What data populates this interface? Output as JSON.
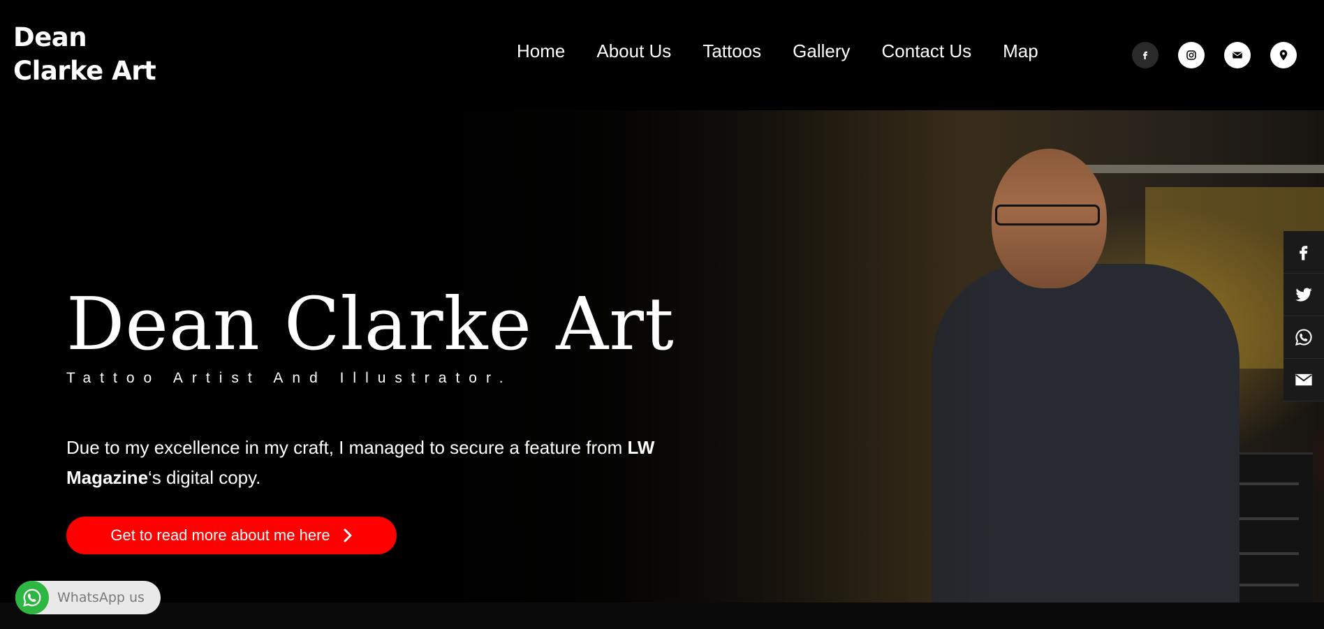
{
  "header": {
    "logo_line1": "Dean",
    "logo_line2": "Clarke Art",
    "nav": [
      {
        "label": "Home"
      },
      {
        "label": "About Us"
      },
      {
        "label": "Tattoos"
      },
      {
        "label": "Gallery"
      },
      {
        "label": "Contact Us"
      },
      {
        "label": "Map"
      }
    ],
    "social_icons": [
      "facebook-icon",
      "instagram-icon",
      "envelope-icon",
      "map-pin-icon"
    ]
  },
  "hero": {
    "title": "Dean Clarke Art",
    "subtitle": "Tattoo Artist And Illustrator.",
    "text_part1": "Due to my excellence in my craft, I managed to secure a feature from ",
    "text_bold": "LW Magazine",
    "text_part2": "‘s digital copy.",
    "cta_label": "Get to read more about me here"
  },
  "share_bar": [
    "facebook-icon",
    "twitter-icon",
    "whatsapp-icon",
    "envelope-icon"
  ],
  "whatsapp": {
    "label": "WhatsApp us"
  },
  "colors": {
    "accent": "#ff0000",
    "background": "#000000",
    "whatsapp_green": "#2db742"
  }
}
